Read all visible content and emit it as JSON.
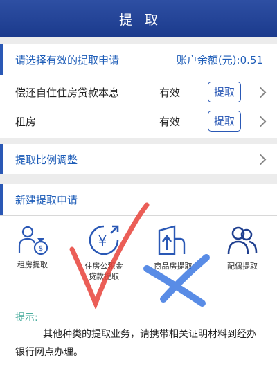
{
  "header": {
    "title": "提取"
  },
  "select_section": {
    "title": "请选择有效的提取申请",
    "balance": "账户余额(元):0.51"
  },
  "applications": [
    {
      "name": "偿还自住住房贷款本息",
      "status": "有效",
      "action": "提取"
    },
    {
      "name": "租房",
      "status": "有效",
      "action": "提取"
    }
  ],
  "ratio_section": {
    "title": "提取比例调整"
  },
  "new_section": {
    "title": "新建提取申请"
  },
  "types": [
    {
      "label": "租房提取",
      "icon": "money-bag-person-icon"
    },
    {
      "label": "住房公积金贷款提取",
      "icon": "yen-refresh-icon"
    },
    {
      "label": "商品房提取",
      "icon": "building-upload-icon"
    },
    {
      "label": "配偶提取",
      "icon": "couple-icon"
    }
  ],
  "tip": {
    "title": "提示:",
    "body": "其他种类的提取业务，请携带相关证明材料到经办银行网点办理。"
  },
  "colors": {
    "header": "#1b3a8c",
    "accent": "#1e5db8",
    "tip": "#4cae9f",
    "check_mark": "#e8423a",
    "cross_mark": "#2f6fe0"
  }
}
